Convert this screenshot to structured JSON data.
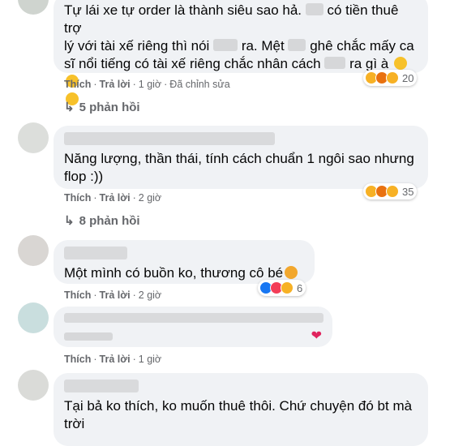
{
  "comments": [
    {
      "text_line1_a": "Tự lái xe tự order là thành siêu sao hả.",
      "text_line1_b": "có tiền thuê trợ",
      "text_line2_a": "lý với tài xế riêng thì nói",
      "text_line2_b": "ra. Mệt",
      "text_line2_c": "ghê chắc mấy ca",
      "text_line3_a": "sĩ nổi tiếng có tài xế riêng chắc nhân cách",
      "text_line3_b": "ra gì à",
      "like": "Thích",
      "reply": "Trả lời",
      "time": "1 giờ",
      "edited": "Đã chỉnh sửa",
      "reaction_count": "20",
      "replies": "5 phản hồi"
    },
    {
      "text": "Năng lượng, thần thái, tính cách chuẩn 1 ngôi sao nhưng flop :))",
      "like": "Thích",
      "reply": "Trả lời",
      "time": "2 giờ",
      "reaction_count": "35",
      "replies": "8 phản hồi"
    },
    {
      "text": "Một mình có buồn ko, thương cô bé",
      "like": "Thích",
      "reply": "Trả lời",
      "time": "2 giờ",
      "reaction_count": "6"
    },
    {
      "like": "Thích",
      "reply": "Trả lời",
      "time": "1 giờ"
    },
    {
      "text": "Tại bả ko thích, ko muốn thuê thôi. Chứ chuyện đó bt mà trời"
    }
  ],
  "icons": [
    "reply-arrow-icon",
    "haha-reaction-icon",
    "angry-reaction-icon",
    "sad-reaction-icon",
    "like-reaction-icon",
    "love-reaction-icon",
    "heart-icon"
  ],
  "colors": {
    "bubble": "#f0f2f5",
    "meta": "#65676b",
    "text": "#050505",
    "like": "#1877f2",
    "love": "#f33e58",
    "haha": "#f7b125"
  }
}
